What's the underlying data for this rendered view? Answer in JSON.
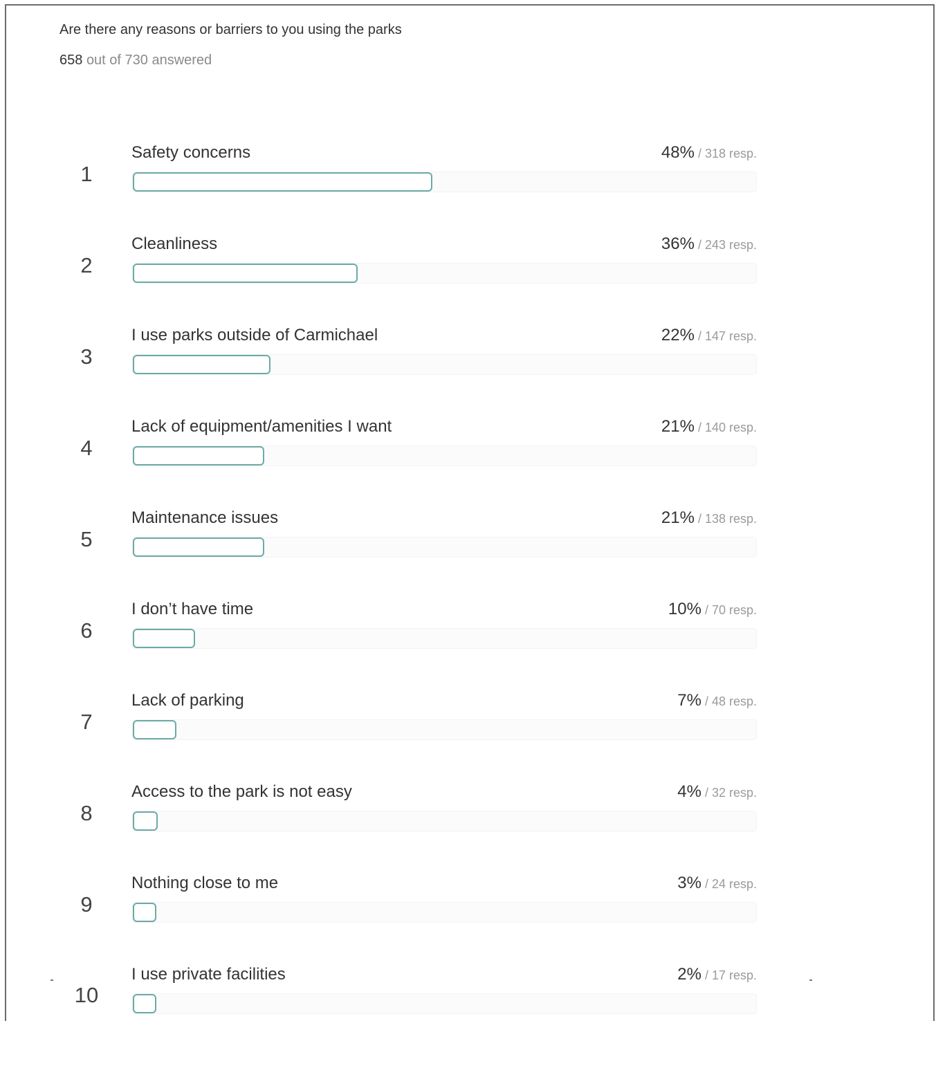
{
  "header": {
    "title": "Are there any reasons or barriers to you using the parks",
    "answered_count": "658",
    "answered_suffix": "out of 730 answered"
  },
  "chart_data": {
    "type": "bar",
    "orientation": "horizontal",
    "title": "Are there any reasons or barriers to you using the parks",
    "total_answered": 658,
    "total_respondents": 730,
    "ranks": [
      "1",
      "2",
      "3",
      "4",
      "5",
      "6",
      "7",
      "8",
      "9",
      "10"
    ],
    "categories": [
      "Safety concerns",
      "Cleanliness",
      "I use parks outside of Carmichael",
      "Lack of equipment/amenities I want",
      "Maintenance issues",
      "I don’t have time",
      "Lack of parking",
      "Access to the park is not easy",
      "Nothing close to me",
      "I use private facilities"
    ],
    "percent_values": [
      48,
      36,
      22,
      21,
      21,
      10,
      7,
      4,
      3,
      2
    ],
    "percent_labels": [
      "48%",
      "36%",
      "22%",
      "21%",
      "21%",
      "10%",
      "7%",
      "4%",
      "3%",
      "2%"
    ],
    "responses": [
      318,
      243,
      147,
      140,
      138,
      70,
      48,
      32,
      24,
      17
    ],
    "response_labels": [
      "/ 318 resp.",
      "/ 243 resp.",
      "/ 147 resp.",
      "/ 140 resp.",
      "/ 138 resp.",
      "/ 70 resp.",
      "/ 48 resp.",
      "/ 32 resp.",
      "/ 24 resp.",
      "/ 17 resp."
    ],
    "xlim": [
      0,
      100
    ],
    "bar_color": "#6aaaa6",
    "track_color": "#fbfbfb",
    "legend": "none",
    "grid": false
  }
}
